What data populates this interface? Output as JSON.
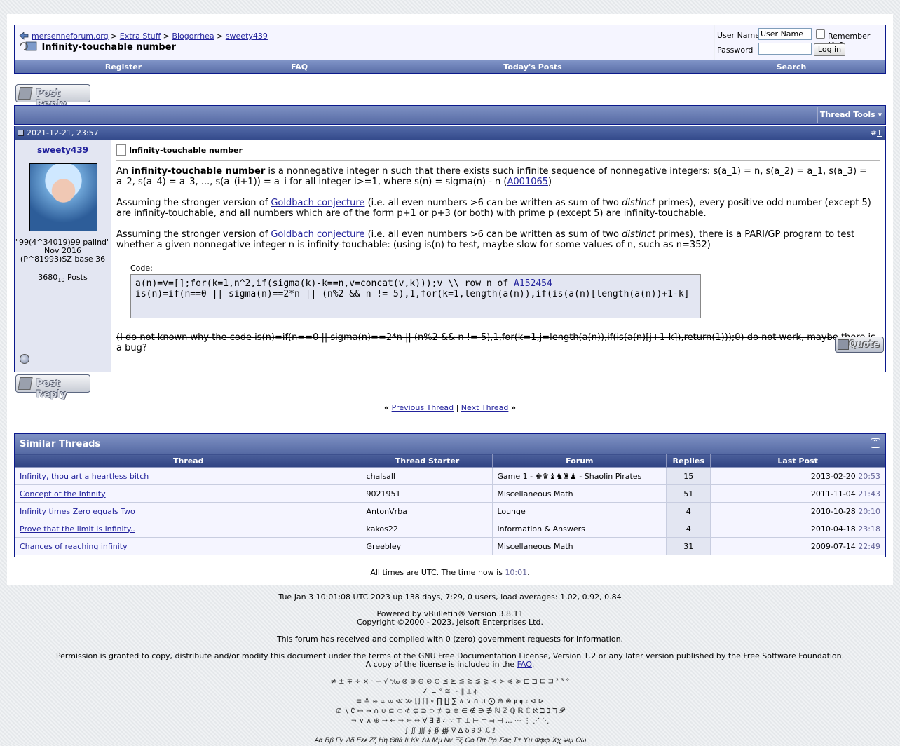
{
  "breadcrumb": [
    "mersenneforum.org",
    "Extra Stuff",
    "Blogorrhea",
    "sweety439"
  ],
  "thread_title": "Infinity-touchable number",
  "login": {
    "username_label": "User Name",
    "username_value": "User Name",
    "password_label": "Password",
    "remember_label": "Remember Me?",
    "login_button": "Log in"
  },
  "navlinks": [
    "Register",
    "FAQ",
    "Today's Posts",
    "Search"
  ],
  "post_reply": "Post Reply",
  "thread_tools": "Thread Tools",
  "post": {
    "date": "2021-12-21, 23:57",
    "number": "1",
    "username": "sweety439",
    "user_title_1": "\"99(4^34019)99 palind\"",
    "user_title_2": "Nov 2016",
    "user_title_3": "(P^81993)SZ base 36",
    "posts_count": "3680",
    "posts_sub": "10",
    "posts_label": "Posts",
    "title": "Infinity-touchable number",
    "p1_a": "An ",
    "p1_b": "infinity-touchable number",
    "p1_c": " is a nonnegative integer n such that there exists such infinite sequence of nonnegative integers: s(a_1) = n, s(a_2) = a_1, s(a_3) = a_2, s(a_4) = a_3, ..., s(a_(i+1)) = a_i for all integer i>=1, where s(n) = sigma(n) - n (",
    "p1_link": "A001065",
    "p1_d": ")",
    "p2_a": "Assuming the stronger version of ",
    "p2_link": "Goldbach conjecture",
    "p2_b": " (i.e. all even numbers >6 can be written as sum of two ",
    "p2_em": "distinct",
    "p2_c": " primes), every positive odd number (except 5) are infinity-touchable, and all numbers which are of the form p+1 or p+3 (or both) with prime p (except 5) are infinity-touchable.",
    "p3_a": "Assuming the stronger version of ",
    "p3_link": "Goldbach conjecture",
    "p3_b": " (i.e. all even numbers >6 can be written as sum of two ",
    "p3_em": "distinct",
    "p3_c": " primes), there is a PARI/GP program to test whether a given nonnegative integer n is infinity-touchable: (using is(n) to test, maybe slow for some values of n, such as n=352)",
    "code_label": "Code:",
    "code_line1_a": "a(n)=v=[];for(k=1,n^2,if(sigma(k)-k==n,v=concat(v,k)));v \\\\ row n of ",
    "code_line1_link": "A152454",
    "code_line2": "is(n)=if(n==0 || sigma(n)==2*n || (n%2 && n != 5),1,for(k=1,length(a(n)),if(is(a(n)[length(a(n))+1-k]",
    "struck": "(I do not known why the code is(n)=if(n==0 || sigma(n)==2*n || (n%2 && n != 5),1,for(k=1,j=length(a(n)),if(is(a(n)[j+1-k]),return(1)));0) do not work, maybe there is a bug?",
    "quote_label": "Quote"
  },
  "thread_nav": {
    "open": "«",
    "prev": "Previous Thread",
    "sep": "|",
    "next": "Next Thread",
    "close": "»"
  },
  "similar": {
    "title": "Similar Threads",
    "headers": [
      "Thread",
      "Thread Starter",
      "Forum",
      "Replies",
      "Last Post"
    ],
    "rows": [
      {
        "thread": "Infinity, thou art a heartless bitch",
        "starter": "chalsall",
        "forum": "Game 1 - ♚♛♝♞♜♟ - Shaolin Pirates",
        "replies": "15",
        "date": "2013-02-20",
        "time": "20:53"
      },
      {
        "thread": "Concept of the Infinity",
        "starter": "9021951",
        "forum": "Miscellaneous Math",
        "replies": "51",
        "date": "2011-11-04",
        "time": "21:43"
      },
      {
        "thread": "Infinity times Zero equals Two",
        "starter": "AntonVrba",
        "forum": "Lounge",
        "replies": "4",
        "date": "2010-10-28",
        "time": "20:10"
      },
      {
        "thread": "Prove that the limit is infinity..",
        "starter": "kakos22",
        "forum": "Information & Answers",
        "replies": "4",
        "date": "2010-04-18",
        "time": "23:18"
      },
      {
        "thread": "Chances of reaching infinity",
        "starter": "Greebley",
        "forum": "Miscellaneous Math",
        "replies": "31",
        "date": "2009-07-14",
        "time": "22:49"
      }
    ]
  },
  "time_now_prefix": "All times are UTC. The time now is ",
  "time_now": "10:01",
  "time_now_suffix": ".",
  "footer": {
    "uptime": "Tue Jan 3 10:01:08 UTC 2023 up 138 days, 7:29, 0 users, load averages: 1.02, 0.92, 0.84",
    "powered": "Powered by vBulletin® Version 3.8.11",
    "copyright": "Copyright ©2000 - 2023, Jelsoft Enterprises Ltd.",
    "gov": "This forum has received and complied with 0 (zero) government requests for information.",
    "license": "Permission is granted to copy, distribute and/or modify this document under the terms of the GNU Free Documentation License, Version 1.2 or any later version published by the Free Software Foundation.",
    "license2_a": "A copy of the license is included in the ",
    "license2_link": "FAQ",
    "license2_b": ".",
    "sym1": "≠ ± ∓ ÷ × · − √ ‰ ⊗ ⊕ ⊖ ⊘ ⊙ ≤ ≥ ≦ ≧ ≨ ≩ ≺ ≻ ≼ ≽ ⊏ ⊐ ⊑ ⊒ ² ³ °",
    "sym2": "∠ ∟ ° ≅ ~ ‖ ⟂ ⫛",
    "sym3": "≡ ≜ ≈ ∝ ∞ ≪ ≫ ⌊⌋ ⌈⌉ ∘ ∏ ∐ ∑ ∧ ∨ ∩ ∪ ⨀ ⊕ ⊗ 𝖕 𝖖 𝖗 ⊲ ⊳",
    "sym4": "∅ ∖ ∁ ↦ ↣ ∩ ∪ ⊆ ⊂ ⊄ ⊊ ⊇ ⊃ ⊅ ⊋ ⊖ ∈ ∉ ∋ ∌ ℕ ℤ ℚ ℝ ℂ ℵ ℶ ℷ ℸ 𝓟",
    "sym5": "¬ ∨ ∧ ⊕ → ← ⇒ ⇐ ⇔ ∀ ∃ ∄ ∴ ∵ ⊤ ⊥ ⊢ ⊨ ⫤ ⊣ … ⋯ ⋮ ⋰ ⋱",
    "sym6": "∫ ∬ ∭ ∮ ∯ ∰ ∇ ∆ δ ∂ ℱ ℒ ℓ",
    "sym7": "𝛢𝛼 𝛣𝛽 𝛤𝛾 𝛥𝛿 𝛦𝜀𝜖 𝛧𝜁 𝛨𝜂 𝛩𝜃𝜗 𝛪𝜄 𝛫𝜅 𝛬𝜆 𝛭𝜇 𝛮𝜈 𝛯𝜉 𝛰𝜊 𝛱𝜋 𝛲𝜌 𝛴𝜎𝜍 𝛵𝜏 𝛶𝜐 𝛷𝜙𝜑 𝛸𝜒 𝛹𝜓 𝛺𝜔"
  },
  "colors": {
    "header_blue": "#566aa4",
    "border_navy": "#0b198c",
    "link": "#22229c",
    "alt_row": "#e3e6f2"
  }
}
